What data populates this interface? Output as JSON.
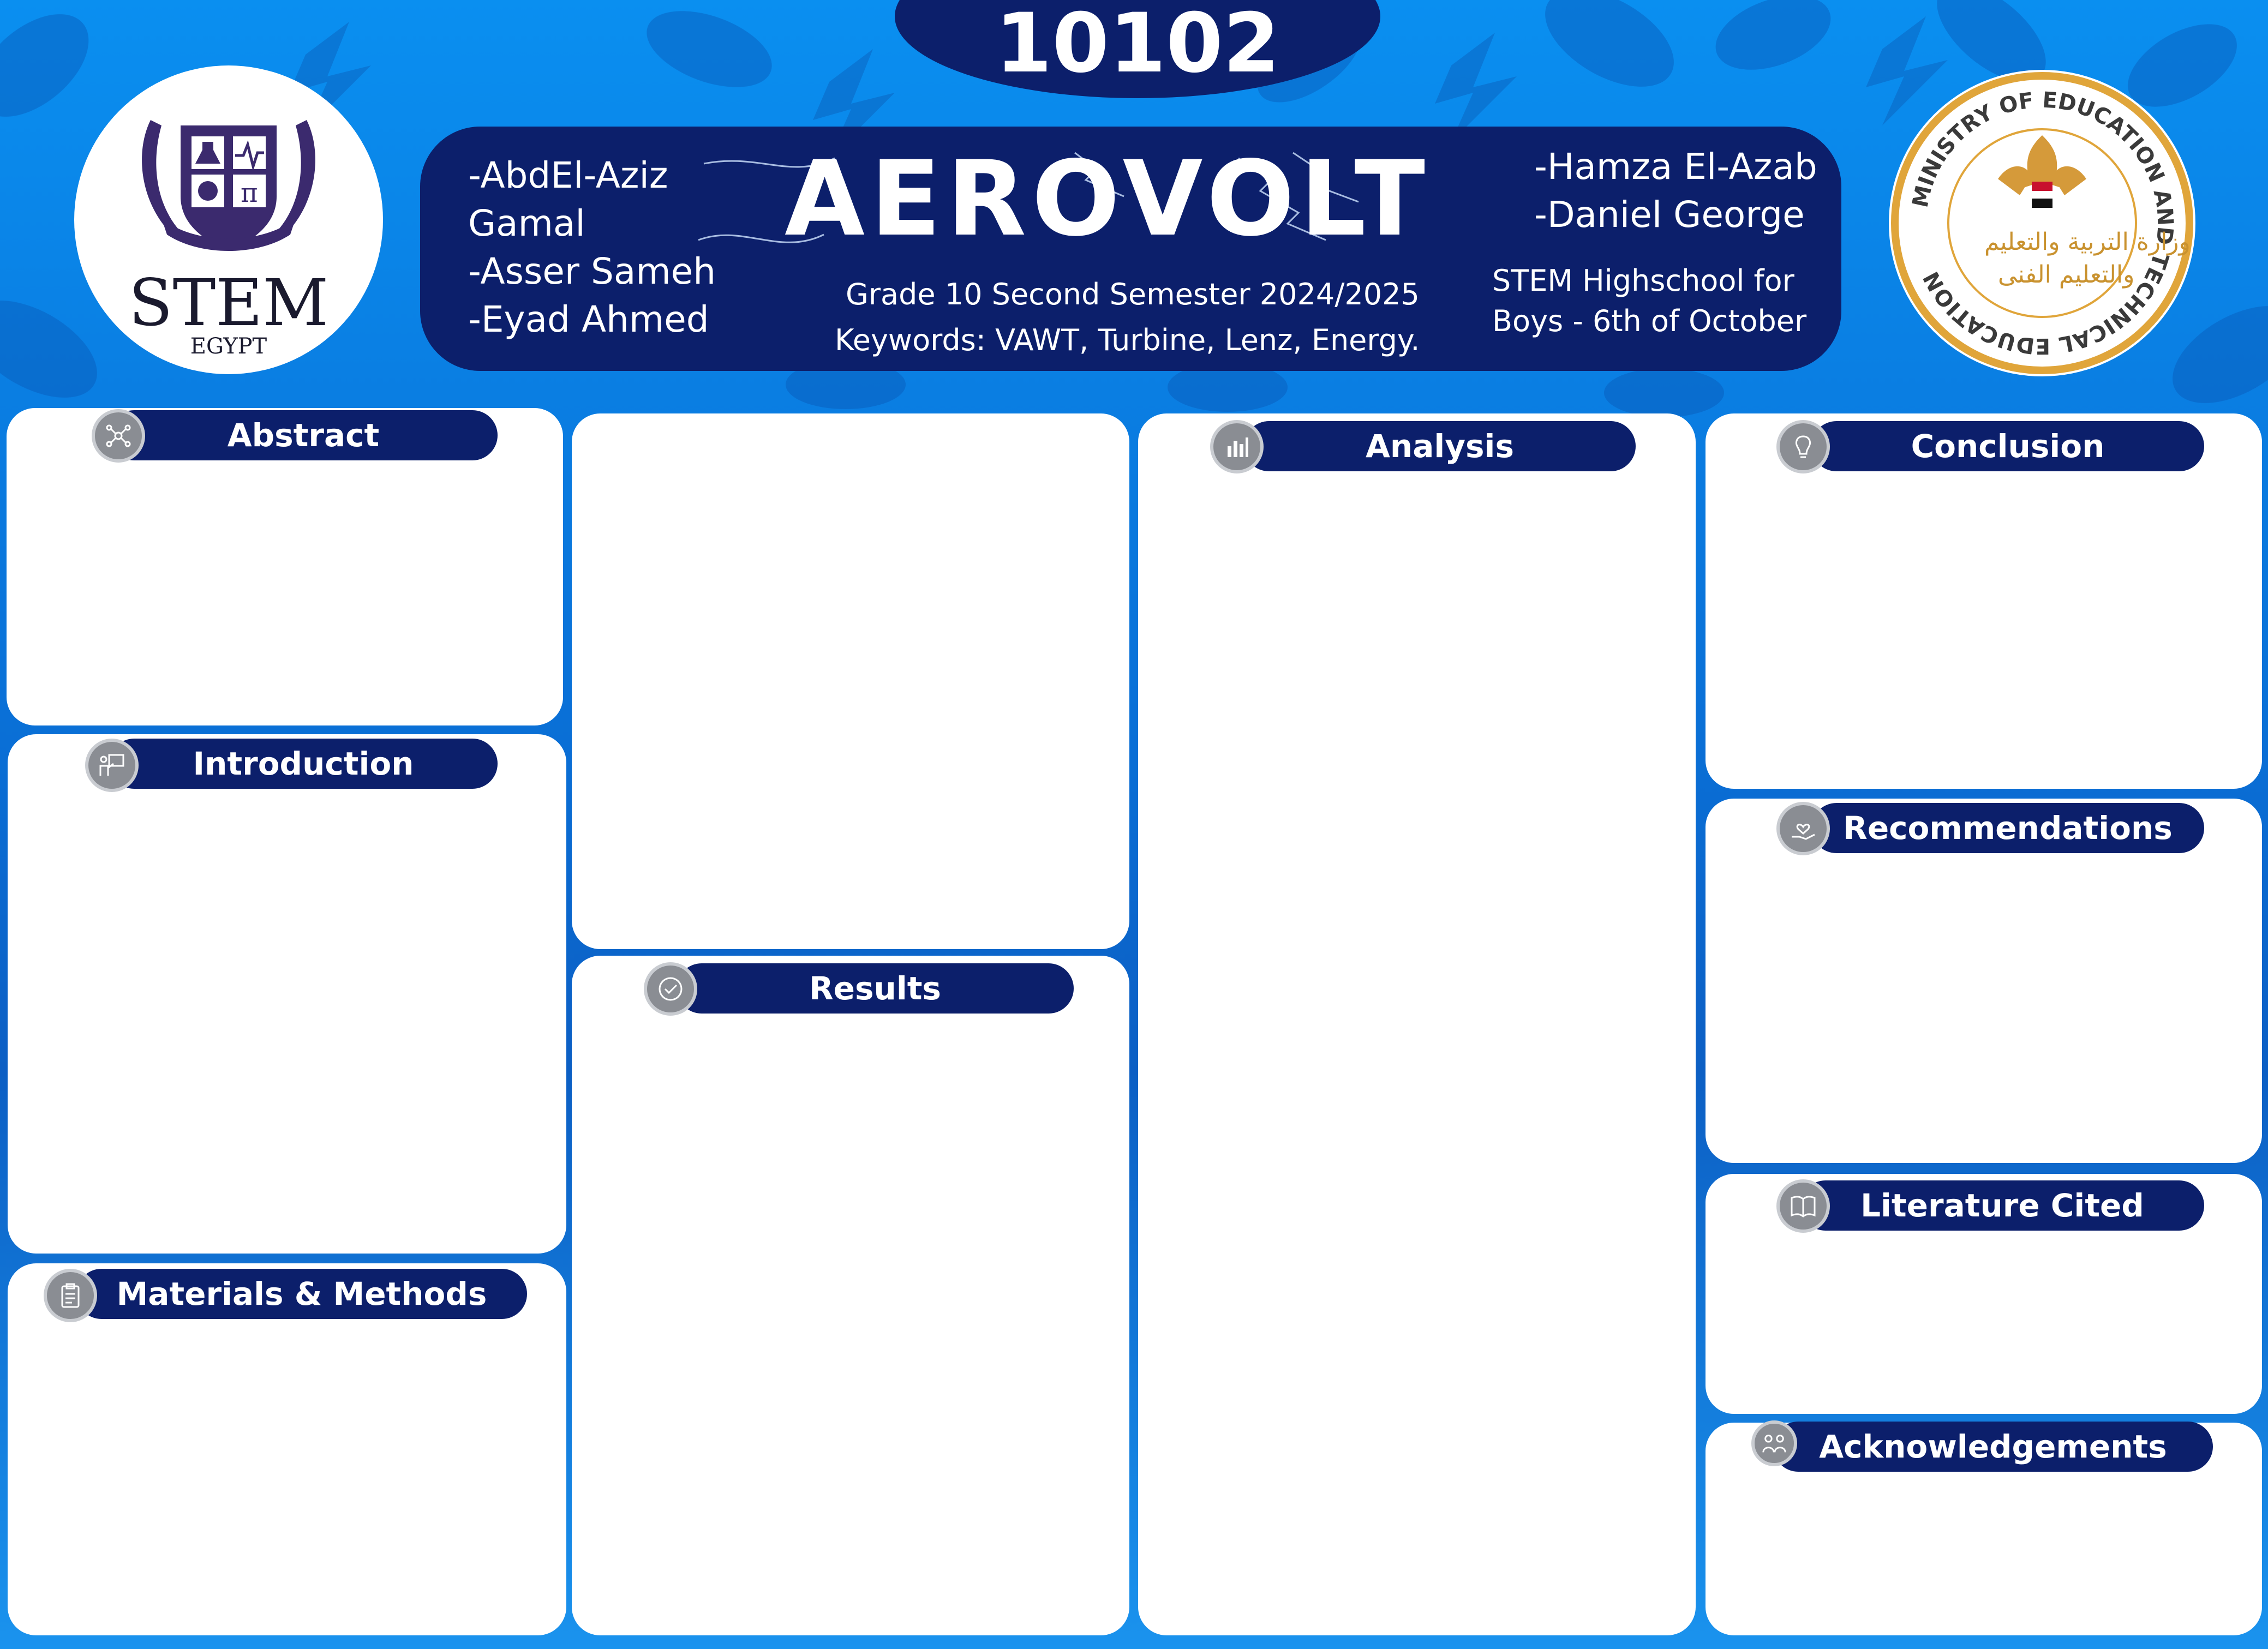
{
  "poster": {
    "id_number": "10102",
    "title_brand": "AEROVOLT",
    "logos": {
      "left_text": "STEM",
      "left_subtext": "EGYPT",
      "right_ring_text": "MINISTRY OF EDUCATION AND TECHNICAL EDUCATION"
    },
    "authors_left": [
      "-AbdEl-Aziz",
      "Gamal",
      "-Asser Sameh",
      "-Eyad Ahmed"
    ],
    "authors_right": [
      "-Hamza El-Azab",
      "-Daniel George"
    ],
    "grade_line": "Grade 10 Second Semester 2024/2025",
    "keywords_line": "Keywords: VAWT, Turbine, Lenz, Energy.",
    "school_lines": [
      "STEM Highschool for",
      "Boys - 6th of October"
    ]
  },
  "sections": {
    "abstract": "Abstract",
    "introduction": "Introduction",
    "materials": "Materials & Methods",
    "results": "Results",
    "analysis": "Analysis",
    "conclusion": "Conclusion",
    "recommendations": "Recommendations",
    "literature": "Literature Cited",
    "acknowledgements": "Acknowledgements"
  },
  "icons": {
    "abstract": "network-icon",
    "introduction": "presenter-icon",
    "materials": "clipboard-icon",
    "results": "check-badge-icon",
    "analysis": "bar-chart-icon",
    "conclusion": "lightbulb-icon",
    "recommendations": "hand-heart-icon",
    "literature": "book-icon",
    "acknowledgements": "people-icon"
  },
  "colors": {
    "navy": "#0c1f6b",
    "background_blue": "#0a7ee4",
    "card": "#ffffff",
    "icon_gray": "#8a8d93",
    "gold_ring": "#e0a53a"
  }
}
